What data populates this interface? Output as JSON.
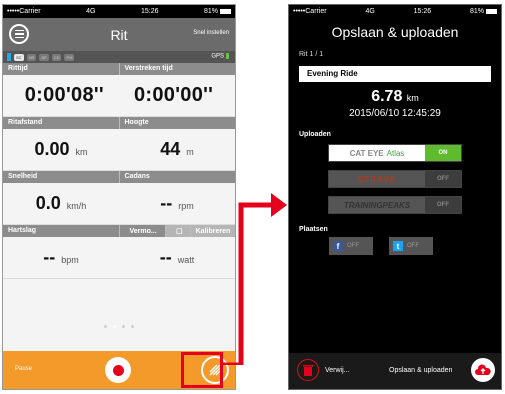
{
  "status_left": {
    "carrier": "•••••Carrier",
    "network": "4G",
    "time": "15:26",
    "battery": "81%"
  },
  "left": {
    "title": "Rit",
    "quick_label": "Snel instellen",
    "gps_label": "GPS",
    "sensors": [
      "SC",
      "HR",
      "SP",
      "CD",
      "PM"
    ],
    "rows": [
      {
        "labels": [
          "Rittijd",
          "Verstreken tijd"
        ],
        "values": [
          "0:00'08''",
          "0:00'00''"
        ]
      },
      {
        "labels": [
          "Ritafstand",
          "Hoogte"
        ],
        "values": [
          "0.00",
          "44"
        ],
        "units": [
          "km",
          "m"
        ]
      },
      {
        "labels": [
          "Snelheid",
          "Cadans"
        ],
        "values": [
          "0.0",
          "--"
        ],
        "units": [
          "km/h",
          "rpm"
        ]
      },
      {
        "labels": [
          "Hartslag",
          "Vermo..."
        ],
        "values": [
          "--",
          "--"
        ],
        "units": [
          "bpm",
          "watt"
        ]
      }
    ],
    "calibrate_label": "Kalibreren",
    "pause_label": "Pause"
  },
  "right": {
    "title": "Opslaan & uploaden",
    "ride_counter": "Rit 1 / 1",
    "ride_name": "Evening Ride",
    "distance": "6.78",
    "distance_unit": "km",
    "datetime": "2015/06/10 12:45:29",
    "upload_label": "Uploaden",
    "services": [
      {
        "name": "CAT EYE",
        "suffix": "Atlas",
        "state": "ON"
      },
      {
        "name": "STRAVA",
        "state": "OFF"
      },
      {
        "name": "TRAININGPEAKS",
        "state": "OFF"
      }
    ],
    "place_label": "Plaatsen",
    "social": [
      {
        "icon": "f",
        "state": "OFF"
      },
      {
        "icon": "t",
        "state": "OFF"
      }
    ],
    "delete_label": "Verwij...",
    "save_upload_label": "Opslaan & uploaden"
  },
  "colors": {
    "orange": "#f39a2b",
    "red": "#e5001c",
    "green": "#5fbb2e"
  }
}
